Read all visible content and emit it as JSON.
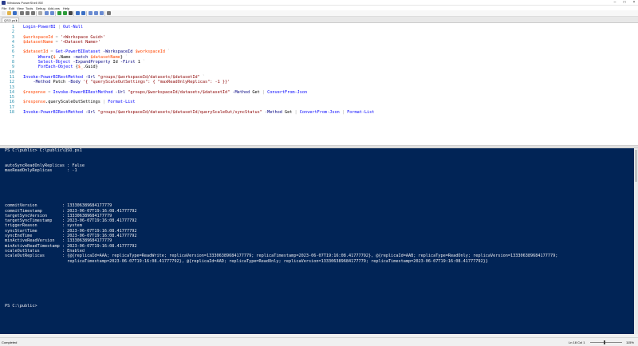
{
  "window": {
    "title": "Windows PowerShell ISE"
  },
  "menu": [
    "File",
    "Edit",
    "View",
    "Tools",
    "Debug",
    "Add-ons",
    "Help"
  ],
  "toolbar_icons": [
    "new-icon",
    "open-icon",
    "save-icon",
    "cut-icon",
    "copy-icon",
    "paste-icon",
    "clear-icon",
    "undo-icon",
    "redo-icon",
    "run-icon",
    "run-selection-icon",
    "stop-icon",
    "remote-icon",
    "console-icon",
    "show-script-pane-top-icon",
    "show-script-pane-right-icon",
    "show-script-pane-max-icon",
    "commands-icon"
  ],
  "tab": {
    "label": "QSO.ps1",
    "close": "×"
  },
  "editor": {
    "line_numbers": [
      "1",
      "2",
      "3",
      "4",
      "5",
      "6",
      "7",
      "8",
      "9",
      "10",
      "11",
      "12",
      "13",
      "14",
      "15",
      "16",
      "17",
      "18"
    ],
    "lines": [
      [
        [
          "cmd",
          "Login-PowerBI"
        ],
        [
          "op",
          " | "
        ],
        [
          "cmd",
          "Out-Null"
        ]
      ],
      [],
      [
        [
          "var",
          "$workspaceId"
        ],
        [
          "op",
          " = "
        ],
        [
          "str",
          "'<Workspace Guid>'"
        ]
      ],
      [
        [
          "var",
          "$datasetName"
        ],
        [
          "op",
          " = "
        ],
        [
          "str",
          "'<Dataset Name>'"
        ]
      ],
      [],
      [
        [
          "var",
          "$datasetId"
        ],
        [
          "op",
          " = "
        ],
        [
          "cmd",
          "Get-PowerBIDataset"
        ],
        [
          "prm",
          " -WorkspaceId "
        ],
        [
          "var",
          "$workspaceId"
        ],
        [
          "op",
          " `"
        ]
      ],
      [
        [
          "op",
          "      "
        ],
        [
          "cmd",
          "Where"
        ],
        [
          "mem",
          "{"
        ],
        [
          "var",
          "$_"
        ],
        [
          "mem",
          ".Name "
        ],
        [
          "prm",
          "-match "
        ],
        [
          "var",
          "$datasetName"
        ],
        [
          "mem",
          "}"
        ],
        [
          "op",
          " `"
        ]
      ],
      [
        [
          "op",
          "      "
        ],
        [
          "cmd",
          "Select-Object"
        ],
        [
          "prm",
          " -ExpandProperty "
        ],
        [
          "mem",
          "Id "
        ],
        [
          "prm",
          "-First "
        ],
        [
          "mem",
          "1 "
        ],
        [
          "op",
          "`"
        ]
      ],
      [
        [
          "op",
          "      "
        ],
        [
          "cmd",
          "ForEach-Object"
        ],
        [
          "mem",
          " {"
        ],
        [
          "var",
          "$_"
        ],
        [
          "mem",
          ".Guid}"
        ]
      ],
      [],
      [
        [
          "cmd",
          "Invoke-PowerBIRestMethod"
        ],
        [
          "prm",
          " -Url "
        ],
        [
          "str",
          "\"groups/$workspaceId/datasets/$datasetId\""
        ],
        [
          "op",
          " `"
        ]
      ],
      [
        [
          "op",
          "    "
        ],
        [
          "prm",
          "-Method "
        ],
        [
          "mem",
          "Patch "
        ],
        [
          "prm",
          "-Body "
        ],
        [
          "str",
          "'{ \"queryScaleOutSettings\": { \"maxReadOnlyReplicas\": -1 }}'"
        ]
      ],
      [],
      [
        [
          "var",
          "$response"
        ],
        [
          "op",
          " = "
        ],
        [
          "cmd",
          "Invoke-PowerBIRestMethod"
        ],
        [
          "prm",
          " -Url "
        ],
        [
          "str",
          "\"groups/$workspaceId/datasets/$datasetId\""
        ],
        [
          "prm",
          " -Method "
        ],
        [
          "mem",
          "Get "
        ],
        [
          "op",
          "| "
        ],
        [
          "cmd",
          "ConvertFrom-Json"
        ]
      ],
      [],
      [
        [
          "var",
          "$response"
        ],
        [
          "mem",
          ".queryScaleOutSettings "
        ],
        [
          "op",
          "| "
        ],
        [
          "cmd",
          "Format-List"
        ]
      ],
      [],
      [
        [
          "cmd",
          "Invoke-PowerBIRestMethod"
        ],
        [
          "prm",
          " -Url "
        ],
        [
          "str",
          "\"groups/$workspaceId/datasets/$datasetId/queryScaleOut/syncStatus\""
        ],
        [
          "prm",
          " -Method "
        ],
        [
          "mem",
          "Get "
        ],
        [
          "op",
          "| "
        ],
        [
          "cmd",
          "ConvertFrom-Json"
        ],
        [
          "op",
          " | "
        ],
        [
          "cmd",
          "Format-List"
        ]
      ]
    ]
  },
  "console": {
    "lines": [
      "PS C:\\public> C:\\public\\QSO.ps1",
      "",
      "",
      "autoSyncReadOnlyReplicas : False",
      "maxReadOnlyReplicas      : -1",
      "",
      "",
      "",
      "",
      "",
      "",
      "commitVersion          : 133306389684177779",
      "commitTimestamp        : 2023-06-07T19:16:08.41777792",
      "targetSyncVersion      : 133306389684177779",
      "targetSyncTimestamp    : 2023-06-07T19:16:08.41777792",
      "triggerReason          : system",
      "syncStartTime          : 2023-06-07T19:16:08.41777792",
      "syncEndTime            : 2023-06-07T19:16:08.41777792",
      "minActiveReadVersion   : 133306389684177779",
      "minActiveReadTimestamp : 2023-06-07T19:16:08.41777792",
      "scaleOutStatus         : Enabled",
      "scaleOutReplicas       : {@{replicaId=AAA; replicaType=ReadWrite; replicaVersion=133306389684177779; replicaTimestamp=2023-06-07T19:16:08.41777792}, @{replicaId=AAB; replicaType=ReadOnly; replicaVersion=133306389684177779;",
      "                         replicaTimestamp=2023-06-07T19:16:08.41777792}, @{replicaId=AAD; replicaType=ReadOnly; replicaVersion=133306389684177779; replicaTimestamp=2023-06-07T19:16:08.41777792}}",
      "",
      "",
      "",
      "",
      "",
      "",
      "",
      "",
      "PS C:\\public>"
    ]
  },
  "status": {
    "text": "Completed",
    "position": "Ln 18 Col 1",
    "zoom": "115%"
  },
  "colors": {
    "console_bg": "#012456",
    "cmdlet": "#0000ff",
    "variable": "#ff4500",
    "string": "#8b0000",
    "parameter": "#000080"
  }
}
